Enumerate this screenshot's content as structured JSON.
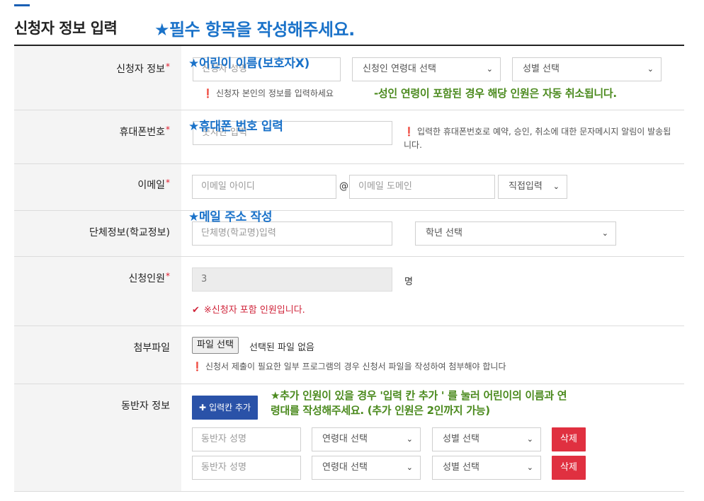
{
  "header": {
    "title": "신청자 정보 입력",
    "note": "★필수 항목을 작성해주세요."
  },
  "colors": {
    "accent": "#1a72c9",
    "required": "#e0192a",
    "note_green": "#4b8a1e",
    "button_blue": "#2a52a8",
    "button_red": "#e03040"
  },
  "applicant": {
    "label": "신청자 정보",
    "required_mark": "*",
    "name_placeholder": "신청자 성명",
    "age_select": "신청인 연령대 선택",
    "gender_select": "성별 선택",
    "hint": "신청자 본인의 정보를 입력하세요",
    "annotation": "★어린이 이름(보호자X)",
    "warning_note": "-성인 연령이 포함된 경우 해당 인원은 자동 취소됩니다."
  },
  "phone": {
    "label": "휴대폰번호",
    "required_mark": "*",
    "placeholder": "숫자만 입력",
    "hint": "입력한 휴대폰번호로 예약, 승인, 취소에 대한 문자메시지 알림이 발송됩니다.",
    "annotation": "★휴대폰 번호 입력"
  },
  "email": {
    "label": "이메일",
    "required_mark": "*",
    "id_placeholder": "이메일 아이디",
    "at": "@",
    "domain_placeholder": "이메일 도메인",
    "domain_select": "직접입력"
  },
  "group": {
    "label": "단체정보(학교정보)",
    "school_placeholder": "단체명(학교명)입력",
    "grade_select": "학년 선택",
    "annotation": "★메일 주소 작성"
  },
  "count": {
    "label": "신청인원",
    "required_mark": "*",
    "value": "3",
    "unit": "명",
    "notice": "※신청자 포함 인원입니다."
  },
  "attachment": {
    "label": "첨부파일",
    "button": "파일 선택",
    "status": "선택된 파일 없음",
    "hint": "신청서 제출이 필요한 일부 프로그램의 경우 신청서 파일을 작성하여 첨부해야 합니다"
  },
  "companions": {
    "label": "동반자 정보",
    "add_button": "입력칸 추가",
    "annotation": "★추가 인원이 있을 경우 '입력 칸 추가 ' 를 눌러 어린이의 이름과 연령대를 작성해주세요. (추가 인원은 2인까지 가능)",
    "rows": [
      {
        "name_placeholder": "동반자 성명",
        "age_select": "연령대 선택",
        "gender_select": "성별 선택",
        "delete": "삭제"
      },
      {
        "name_placeholder": "동반자 성명",
        "age_select": "연령대 선택",
        "gender_select": "성별 선택",
        "delete": "삭제"
      }
    ]
  }
}
